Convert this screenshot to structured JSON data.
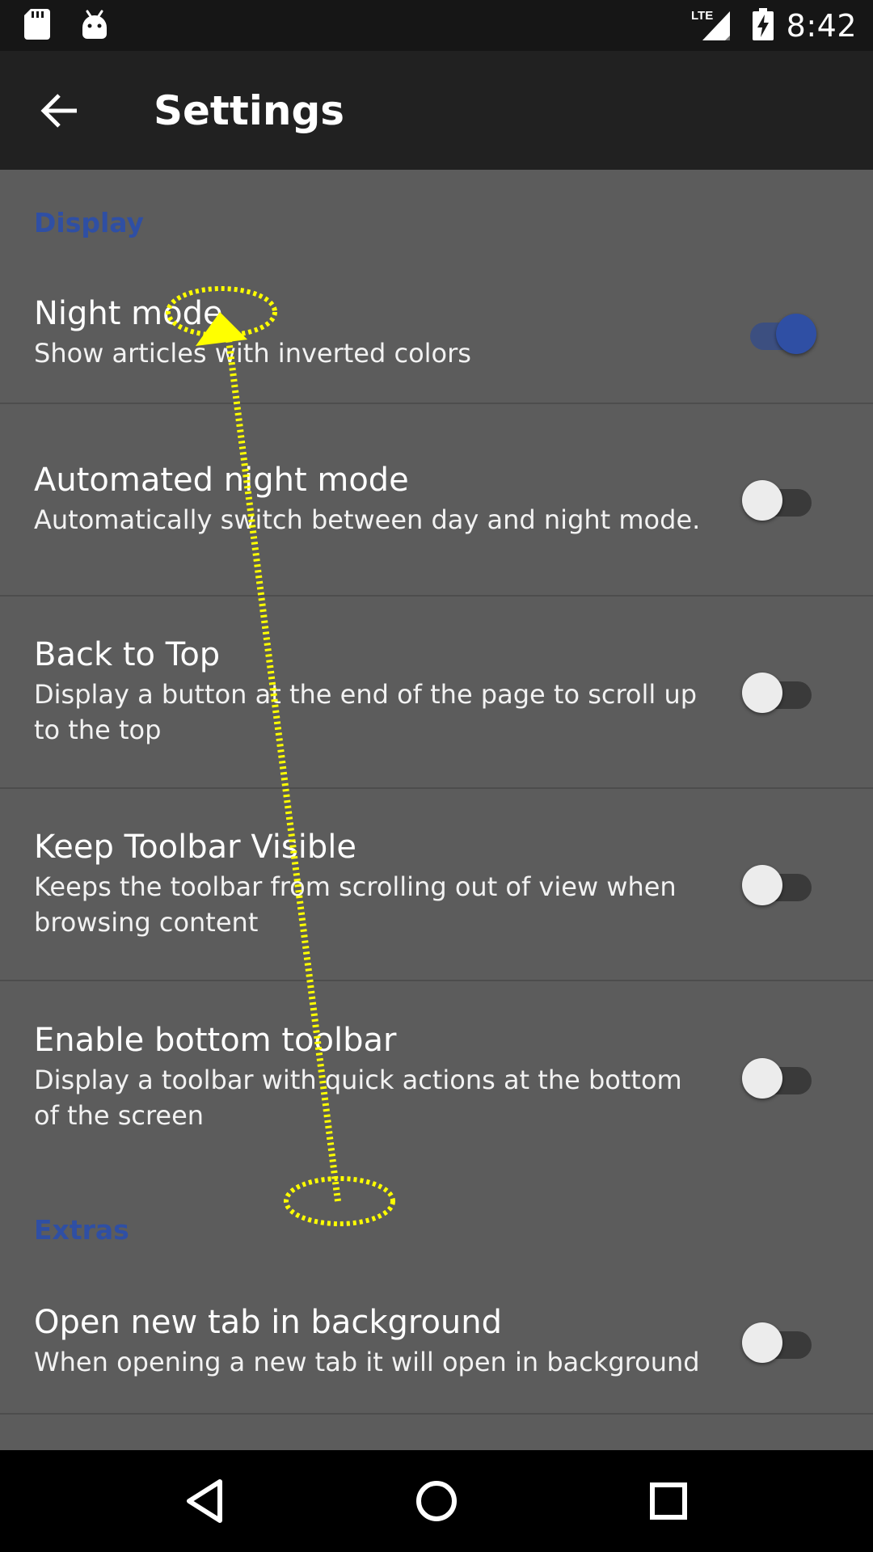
{
  "status_bar": {
    "time": "8:42",
    "network_label": "LTE",
    "icons": [
      "sd-card-icon",
      "android-icon",
      "signal-icon",
      "battery-charging-icon"
    ]
  },
  "app_bar": {
    "title": "Settings",
    "back_icon": "arrow-back-icon"
  },
  "sections": [
    {
      "header": "Display",
      "items": [
        {
          "title": "Night mode",
          "summary": "Show articles with inverted colors",
          "enabled": true
        },
        {
          "title": "Automated night mode",
          "summary": "Automatically switch between day and night mode.",
          "enabled": false
        },
        {
          "title": "Back to Top",
          "summary": "Display a button at the end of the page to scroll up to the top",
          "enabled": false
        },
        {
          "title": "Keep Toolbar Visible",
          "summary": "Keeps the toolbar from scrolling out of view when browsing content",
          "enabled": false
        },
        {
          "title": "Enable bottom toolbar",
          "summary": "Display a toolbar with quick actions at the bottom of the screen",
          "enabled": false
        }
      ]
    },
    {
      "header": "Extras",
      "items": [
        {
          "title": "Open new tab in background",
          "summary": "When opening a new tab it will open in background",
          "enabled": false
        }
      ]
    }
  ],
  "nav_bar": {
    "icons": [
      "back-triangle-icon",
      "home-circle-icon",
      "recents-square-icon"
    ]
  },
  "colors": {
    "accent": "#2f4fa4",
    "background": "#5c5c5c",
    "app_bar": "#212121",
    "status_bar": "#161616",
    "gesture_overlay": "#ffff00"
  }
}
